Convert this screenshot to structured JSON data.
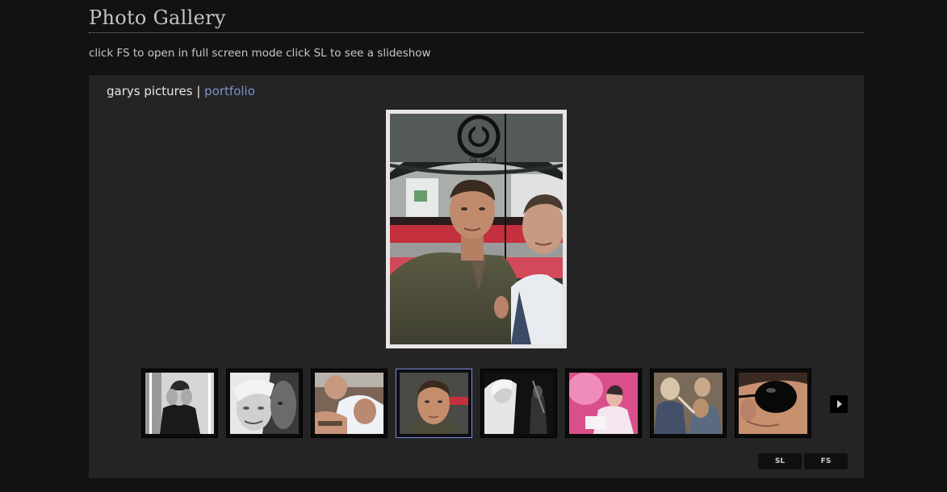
{
  "page": {
    "title": "Photo Gallery",
    "hint": "click FS to open in full screen mode click SL to see a slideshow"
  },
  "gallery": {
    "album": "garys pictures",
    "separator": "|",
    "link": "portfolio",
    "main_photo": "umbrella-selfie-photo",
    "thumbnails": [
      {
        "name": "thumb-man-hand-on-face"
      },
      {
        "name": "thumb-bw-smiling-face"
      },
      {
        "name": "thumb-car-selfie"
      },
      {
        "name": "thumb-man-portrait",
        "active": true
      },
      {
        "name": "thumb-bw-concert"
      },
      {
        "name": "thumb-pink-performer"
      },
      {
        "name": "thumb-crowd"
      },
      {
        "name": "thumb-sunglasses-closeup"
      }
    ],
    "next_icon": "play-right-icon",
    "buttons": {
      "slideshow": "SL",
      "fullscreen": "FS"
    }
  },
  "colors": {
    "background": "#121212",
    "panel": "#242424",
    "link": "#7f8fc8",
    "active_thumb_border": "#7a8be0",
    "main_frame": "#e9e4e8"
  }
}
